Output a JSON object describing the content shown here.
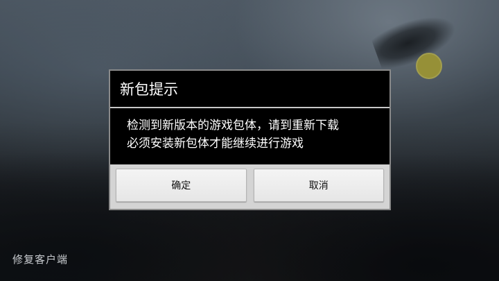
{
  "dialog": {
    "title": "新包提示",
    "message_line1": "检测到新版本的游戏包体，请到重新下载",
    "message_line2": "必须安装新包体才能继续进行游戏",
    "confirm_label": "确定",
    "cancel_label": "取消"
  },
  "footer": {
    "repair_label": "修复客户端"
  },
  "colors": {
    "dialog_background": "#000000",
    "button_area": "#d4d4d4",
    "sun_icon": "#c9c04a"
  }
}
